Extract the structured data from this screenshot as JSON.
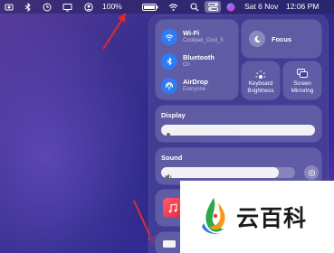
{
  "menubar": {
    "battery_percent": "100%",
    "date": "Sat 6 Nov",
    "time": "12:06 PM"
  },
  "control_center": {
    "wifi": {
      "title": "Wi-Fi",
      "subtitle": "Coolpad_Cool_5"
    },
    "bluetooth": {
      "title": "Bluetooth",
      "subtitle": "On"
    },
    "airdrop": {
      "title": "AirDrop",
      "subtitle": "Everyone"
    },
    "focus": {
      "label": "Focus"
    },
    "keyboard_brightness": {
      "label_line1": "Keyboard",
      "label_line2": "Brightness"
    },
    "screen_mirroring": {
      "label_line1": "Screen",
      "label_line2": "Mirroring"
    },
    "display": {
      "title": "Display",
      "level": 1.0
    },
    "sound": {
      "title": "Sound",
      "level": 0.88
    }
  },
  "watermark": {
    "text": "云百科"
  },
  "colors": {
    "accent_blue": "#2f7bf5",
    "arrow_red": "#e0282e",
    "panel": "#4a4696"
  }
}
